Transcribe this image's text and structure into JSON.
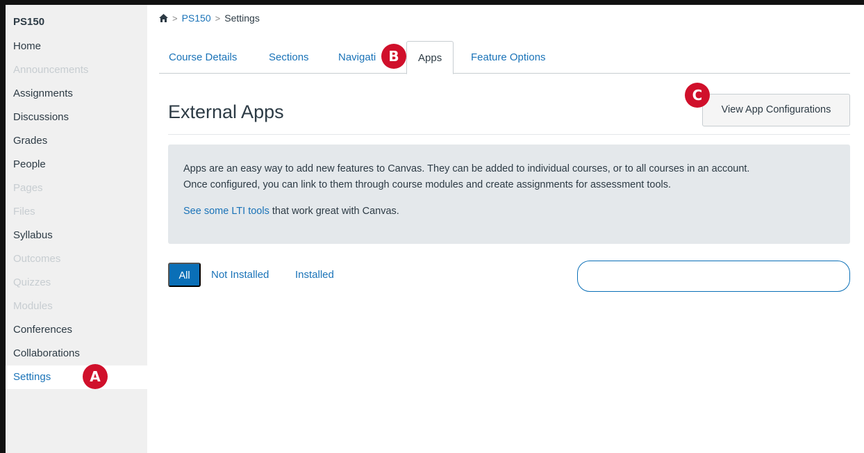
{
  "sidebar": {
    "course": "PS150",
    "items": [
      {
        "label": "Home",
        "state": "normal"
      },
      {
        "label": "Announcements",
        "state": "disabled"
      },
      {
        "label": "Assignments",
        "state": "normal"
      },
      {
        "label": "Discussions",
        "state": "normal"
      },
      {
        "label": "Grades",
        "state": "normal"
      },
      {
        "label": "People",
        "state": "normal"
      },
      {
        "label": "Pages",
        "state": "disabled"
      },
      {
        "label": "Files",
        "state": "disabled"
      },
      {
        "label": "Syllabus",
        "state": "normal"
      },
      {
        "label": "Outcomes",
        "state": "disabled"
      },
      {
        "label": "Quizzes",
        "state": "disabled"
      },
      {
        "label": "Modules",
        "state": "disabled"
      },
      {
        "label": "Conferences",
        "state": "normal"
      },
      {
        "label": "Collaborations",
        "state": "normal"
      },
      {
        "label": "Settings",
        "state": "active"
      }
    ]
  },
  "breadcrumb": {
    "home_icon": "home-icon",
    "course": "PS150",
    "current": "Settings",
    "separator": ">"
  },
  "tabs": [
    {
      "label": "Course Details"
    },
    {
      "label": "Sections"
    },
    {
      "label": "Navigati"
    },
    {
      "label": "Apps"
    },
    {
      "label": "Feature Options"
    }
  ],
  "badges": {
    "a": "A",
    "b": "B",
    "c": "C"
  },
  "main": {
    "title": "External Apps",
    "view_config_label": "View App Configurations",
    "info_line1": "Apps are an easy way to add new features to Canvas. They can be added to individual courses, or to all courses in an account.",
    "info_line2": "Once configured, you can link to them through course modules and create assignments for assessment tools.",
    "info_link": "See some LTI tools",
    "info_link_suffix": " that work great with Canvas.",
    "filters": {
      "all": "All",
      "not_installed": "Not Installed",
      "installed": "Installed"
    },
    "search_value": ""
  },
  "colors": {
    "accent": "#1a73b8",
    "badge": "#d0102b",
    "button_primary": "#0a6fb7"
  }
}
